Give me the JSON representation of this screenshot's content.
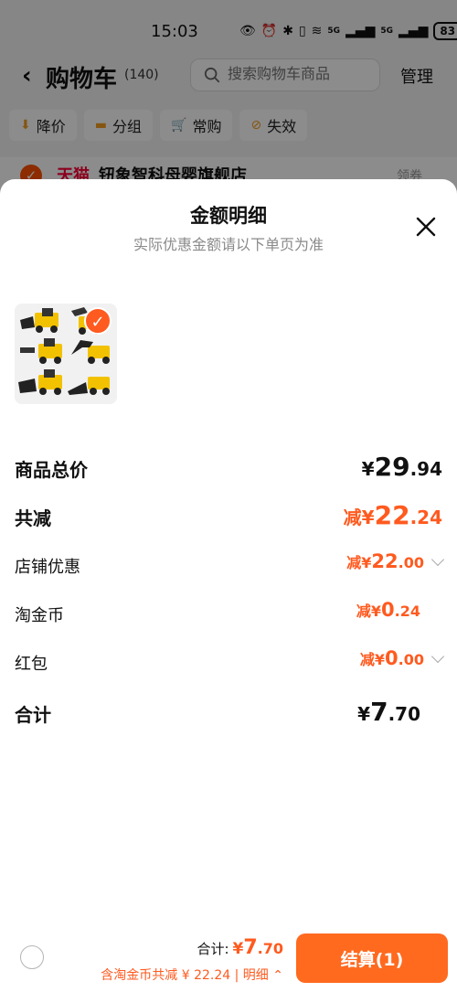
{
  "status": {
    "time": "15:03",
    "net1": "5G",
    "net2": "5G",
    "battery": "83"
  },
  "header": {
    "title": "购物车",
    "count": "(140)",
    "search_placeholder": "搜索购物车商品",
    "manage_label": "管理"
  },
  "filters": [
    {
      "label": "降价",
      "icon": "price-down-icon"
    },
    {
      "label": "分组",
      "icon": "folder-icon"
    },
    {
      "label": "常购",
      "icon": "cart-icon"
    },
    {
      "label": "失效",
      "icon": "invalid-icon"
    }
  ],
  "shop": {
    "tag": "天猫",
    "name": "钮象智科母婴旗舰店",
    "coupon": "领券"
  },
  "sheet": {
    "title": "金额明细",
    "subtitle": "实际优惠金额请以下单页为准",
    "rows": [
      {
        "label": "商品总价",
        "cur": "¥",
        "int": "29",
        "dec": ".94"
      },
      {
        "label": "共减",
        "prefix": "减",
        "cur": "¥",
        "int": "22",
        "dec": ".24"
      },
      {
        "label": "店铺优惠",
        "prefix": "减",
        "cur": "¥",
        "int": "22",
        "dec": ".00"
      },
      {
        "label": "淘金币",
        "prefix": "减",
        "cur": "¥",
        "int": "0",
        "dec": ".24"
      },
      {
        "label": "红包",
        "prefix": "减",
        "cur": "¥",
        "int": "0",
        "dec": ".00"
      },
      {
        "label": "合计",
        "cur": "¥",
        "int": "7",
        "dec": ".70"
      }
    ]
  },
  "bottom": {
    "total_label": "合计:",
    "total_cur": "¥",
    "total_int": "7",
    "total_dec": ".70",
    "discount_text": "含淘金币共减 ¥ 22.24 | 明细 ",
    "checkout_label": "结算(1)"
  },
  "colors": {
    "accent": "#ff5a1f",
    "checkout": "#ff6a1f"
  }
}
